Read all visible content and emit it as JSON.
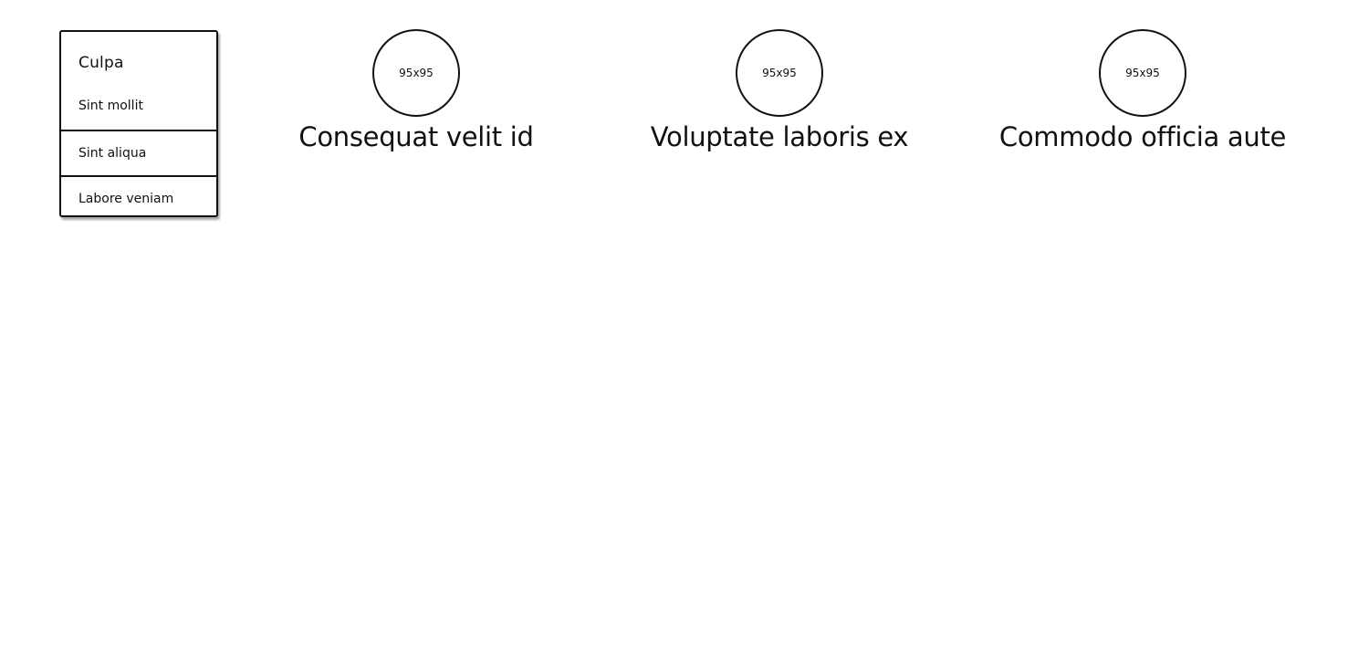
{
  "side_menu": {
    "title": "Culpa",
    "items": [
      {
        "label": "Sint mollit"
      },
      {
        "label": "Sint aliqua"
      },
      {
        "label": "Labore veniam"
      }
    ]
  },
  "cards": [
    {
      "avatar_text": "95x95",
      "title": "Consequat velit id"
    },
    {
      "avatar_text": "95x95",
      "title": "Voluptate laboris ex"
    },
    {
      "avatar_text": "95x95",
      "title": "Commodo officia aute"
    }
  ]
}
